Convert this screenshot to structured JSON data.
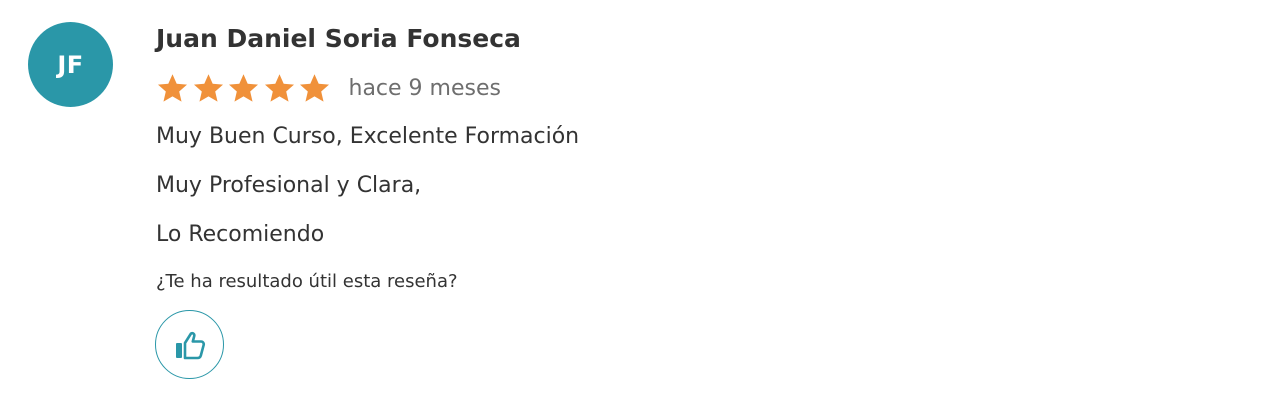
{
  "review": {
    "avatar_initials": "JF",
    "avatar_color": "#2a97a8",
    "author_name": "Juan Daniel Soria Fonseca",
    "rating": 5,
    "rating_max": 5,
    "star_color": "#f0913a",
    "time_ago": "hace 9 meses",
    "body_lines": [
      "Muy Buen Curso, Excelente Formación",
      "Muy Profesional y Clara,",
      "Lo Recomiendo"
    ],
    "helpful_question": "¿Te ha resultado útil esta reseña?",
    "like_icon": "thumbs-up-icon"
  }
}
